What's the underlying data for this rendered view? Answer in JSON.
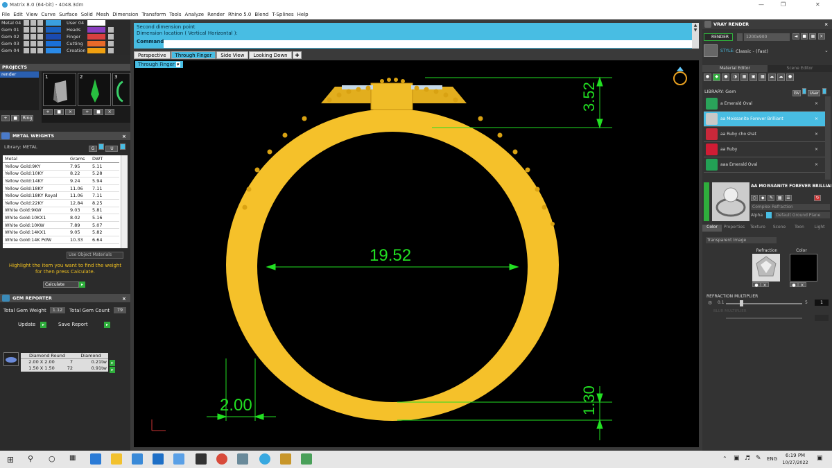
{
  "window": {
    "title": "Matrix 8.0 (64-bit) - 4048.3dm"
  },
  "menu": [
    "File",
    "Edit",
    "View",
    "Curve",
    "Surface",
    "Solid",
    "Mesh",
    "Dimension",
    "Transform",
    "Tools",
    "Analyze",
    "Render",
    "Rhino 5.0",
    "Blend",
    "T-Splines",
    "Help"
  ],
  "layers": {
    "left": [
      "Metal 04",
      "Gem 01",
      "Gem 02",
      "Gem 03",
      "Gem 04"
    ],
    "right": [
      "User 04",
      "Heads",
      "Finger",
      "Cutting",
      "Creation"
    ],
    "right_colors": [
      "#ffffff",
      "#8a3fbf",
      "#d94040",
      "#e86a2a",
      "#f0a010"
    ]
  },
  "projects": {
    "title": "PROJECTS",
    "items": [
      "render"
    ],
    "thumb_numbers": [
      "1",
      "2",
      "3"
    ],
    "ring_button": "Ring"
  },
  "metal_weights": {
    "title": "METAL WEIGHTS",
    "library_label": "Library: METAL",
    "headers": [
      "Metal",
      "Grams",
      "DWT"
    ],
    "rows": [
      [
        "Yellow Gold:9KY",
        "7.95",
        "5.11"
      ],
      [
        "Yellow Gold:10KY",
        "8.22",
        "5.28"
      ],
      [
        "Yellow Gold:14KY",
        "9.24",
        "5.94"
      ],
      [
        "Yellow Gold:18KY",
        "11.06",
        "7.11"
      ],
      [
        "Yellow Gold:18KY Royal",
        "11.06",
        "7.11"
      ],
      [
        "Yellow Gold:22KY",
        "12.84",
        "8.25"
      ],
      [
        "White Gold:9KW",
        "9.03",
        "5.81"
      ],
      [
        "White Gold:10KX1",
        "8.02",
        "5.16"
      ],
      [
        "White Gold:10KW",
        "7.89",
        "5.07"
      ],
      [
        "White Gold:14KX1",
        "9.05",
        "5.82"
      ],
      [
        "White Gold:14K PdW",
        "10.33",
        "6.64"
      ]
    ],
    "use_object_materials": "Use Object Materials",
    "instruction": "Highlight the item you want to find the weight for then press Calculate.",
    "calculate": "Calculate"
  },
  "gem_reporter": {
    "title": "GEM REPORTER",
    "total_weight_label": "Total Gem Weight",
    "total_weight": "1.12",
    "total_count_label": "Total Gem Count",
    "total_count": "79",
    "update": "Update",
    "save_report": "Save Report",
    "headers": [
      "Diamond Round",
      "Diamond"
    ],
    "rows": [
      [
        "2.00 X 2.00",
        "7",
        "0.21tw"
      ],
      [
        "1.50 X 1.50",
        "72",
        "0.91tw"
      ]
    ]
  },
  "command": {
    "line1": "Second dimension point",
    "line2": "Dimension location ( Vertical  Horizontal ):",
    "prompt": "Command:"
  },
  "view_tabs": [
    "Perspective",
    "Through Finger",
    "Side View",
    "Looking Down"
  ],
  "active_view": "Through Finger",
  "dimensions": {
    "inner_diameter": "19.52",
    "top_height": "3.52",
    "band_width": "2.00",
    "bottom_thickness": "1.30",
    "dimension_color": "#22e022",
    "metal_color": "#f5c12a"
  },
  "vray": {
    "title": "VRAY RENDER",
    "render_button": "RENDER",
    "resolution": "1200x900",
    "style_label": "STYLE:",
    "style_value": "Classic - (Fast)",
    "tab_material": "Material Editor",
    "tab_scene": "Scene Editor",
    "library_label": "LIBRARY: Gem",
    "lib_btn1": "GV",
    "lib_btn2": "User",
    "materials": [
      {
        "name": "a Emerald Oval",
        "color": "#2aa35a"
      },
      {
        "name": "aa Moissanite Forever Brilliant",
        "color": "#c8c8c8"
      },
      {
        "name": "aa Ruby cho shat",
        "color": "#c8283a"
      },
      {
        "name": "aa Ruby",
        "color": "#d01c34"
      },
      {
        "name": "aaa Emerald Oval",
        "color": "#23a055"
      }
    ],
    "selected_index": 1,
    "selected_name": "AA MOISSANITE FOREVER BRILLIANT",
    "material_type": "Complex Refraction",
    "alpha_label": "Alpha",
    "ground_plane": "Default Ground Plane",
    "subtabs": [
      "Color",
      "Properties",
      "Texture",
      "Scene",
      "Toon",
      "Light"
    ],
    "layer_type": "Transparent Image",
    "refraction_label": "Refraction",
    "color_label": "Color",
    "refraction_multiplier_label": "REFRACTION MULTIPLIER",
    "slider_min": "0.1",
    "slider_max": "5",
    "slider_value": "1",
    "dim_label": "BLUR MULTIPLIER"
  },
  "taskbar": {
    "lang": "ENG",
    "time": "6:19 PM",
    "date": "10/27/2022"
  }
}
